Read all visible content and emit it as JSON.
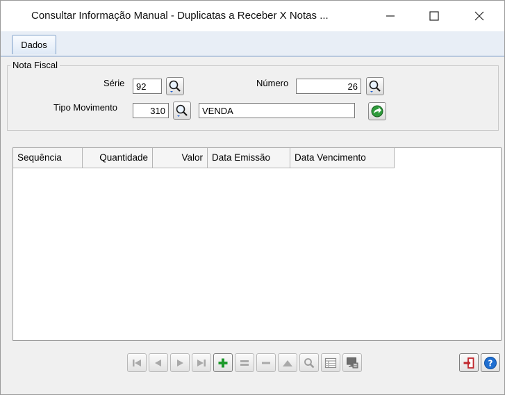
{
  "window": {
    "title": "Consultar Informação Manual - Duplicatas a Receber X Notas ..."
  },
  "tabs": [
    {
      "label": "Dados"
    }
  ],
  "nota_fiscal": {
    "group_label": "Nota Fiscal",
    "serie_label": "Série",
    "serie_value": "92",
    "numero_label": "Número",
    "numero_value": "26",
    "tipo_movimento_label": "Tipo Movimento",
    "tipo_movimento_code": "310",
    "tipo_movimento_desc": "VENDA"
  },
  "grid": {
    "columns": [
      "Sequência",
      "Quantidade",
      "Valor",
      "Data Emissão",
      "Data Vencimento"
    ],
    "rows": []
  },
  "toolbar": {
    "buttons": [
      "first-icon",
      "previous-icon",
      "next-icon",
      "last-icon",
      "add-icon",
      "edit-icon",
      "delete-icon",
      "up-icon",
      "search-icon",
      "form-view-icon",
      "monitor-icon"
    ],
    "accent_add": "#1e9a2c",
    "help_color": "#1f6fd1",
    "exit_color": "#c0262c"
  }
}
